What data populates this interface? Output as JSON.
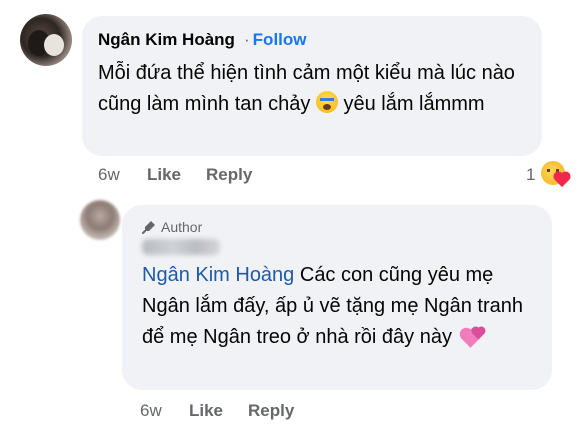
{
  "comment": {
    "author": "Ngân Kim Hoàng",
    "follow_separator": "·",
    "follow_label": "Follow",
    "text_before_emoji": "Mỗi đứa thể hiện tình cảm một kiểu mà lúc nào cũng làm mình tan chảy ",
    "emoji_icon": "crying-face-icon",
    "text_after_emoji": " yêu lắm lắmmm",
    "time": "6w",
    "like_label": "Like",
    "reply_label": "Reply",
    "reaction_count": "1",
    "reaction_icon": "care-reaction-icon"
  },
  "reply": {
    "badge_label": "Author",
    "badge_icon": "microphone-icon",
    "mention": "Ngân Kim Hoàng",
    "text": " Các con cũng yêu mẹ Ngân lắm đấy, ấp ủ vẽ tặng mẹ Ngân tranh để mẹ Ngân treo ở nhà rồi đây này ",
    "emoji_icon": "two-hearts-icon",
    "time": "6w",
    "like_label": "Like",
    "reply_label": "Reply"
  },
  "colors": {
    "bubble": "#f0f2f5",
    "link": "#1877f2",
    "mention": "#1e5aa8",
    "meta": "#65676b"
  }
}
